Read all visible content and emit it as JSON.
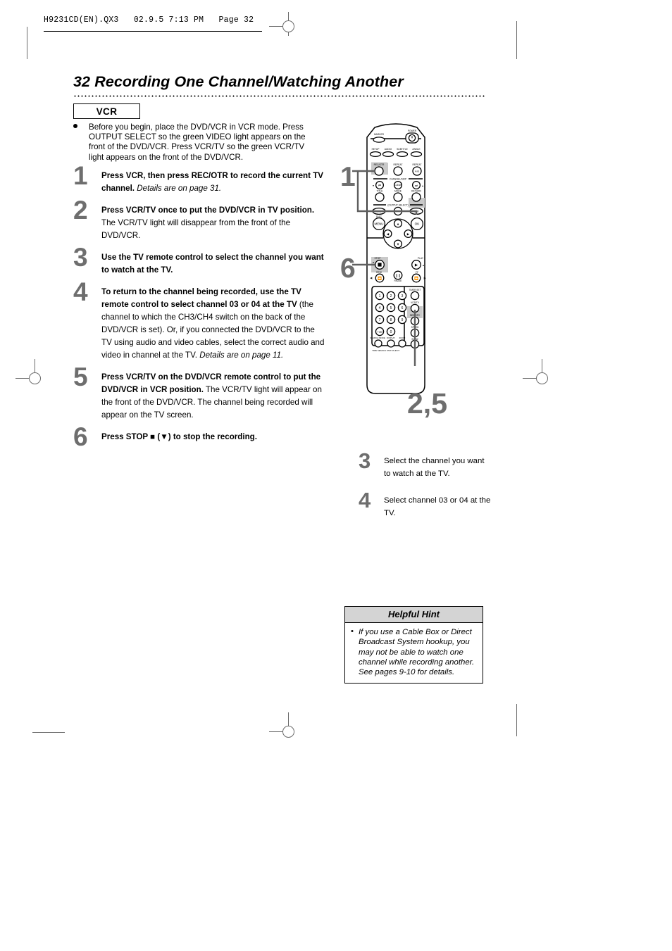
{
  "print_header": {
    "text": "H9231CD(EN).QX3   02.9.5 7:13 PM   Page 32"
  },
  "page": {
    "number": "32",
    "title": "32  Recording One Channel/Watching Another",
    "mode_badge": "VCR"
  },
  "intro": {
    "text": "Before you begin, place the DVD/VCR in VCR mode. Press OUTPUT SELECT so the green VIDEO light appears on the front of the DVD/VCR. Press VCR/TV so the green VCR/TV light appears on the front of the DVD/VCR."
  },
  "steps": [
    {
      "number": "1",
      "bold": "Press VCR, then press REC/OTR to record the current TV channel.",
      "italic": " Details are on page 31.",
      "plain": ""
    },
    {
      "number": "2",
      "bold": "Press VCR/TV once to put the DVD/VCR in TV position.",
      "italic": "",
      "plain": " The VCR/TV light will disappear from the front of the DVD/VCR."
    },
    {
      "number": "3",
      "bold": "Use the TV remote control to select the channel you want to watch at the TV.",
      "italic": "",
      "plain": ""
    },
    {
      "number": "4",
      "bold": "To return to the channel being recorded, use the TV remote control to select channel 03 or 04 at the TV",
      "italic": " Details are on page 11.",
      "plain": " (the channel to which the CH3/CH4 switch on the back of the DVD/VCR is set). Or, if you connected the DVD/VCR to the TV using audio and video cables, select the correct audio and video in channel at the TV."
    },
    {
      "number": "5",
      "bold": "Press VCR/TV on the DVD/VCR remote control to put the DVD/VCR in VCR position.",
      "italic": "",
      "plain": " The VCR/TV light will appear on the front of the DVD/VCR. The channel being recorded will appear on the TV screen."
    },
    {
      "number": "6",
      "bold": "Press STOP ■ (▼) to stop the recording.",
      "italic": "",
      "plain": ""
    }
  ],
  "remote": {
    "callout_top": "1",
    "callout_stop": "6",
    "callout_vcrtv": "2,5",
    "labels": {
      "marker": "MARKER",
      "power": "POWER",
      "setup": "SETUP",
      "audio": "AUDIO",
      "subtitle": "SUBTITLE",
      "angle": "ANGLE",
      "rec_otr": "REC/OTR",
      "repeat": "REPEAT",
      "repeat_ab_top": "REPEAT",
      "repeat_ab": "A-B",
      "channel_skip": "CHANNEL/SKIP",
      "title": "TITLE",
      "clear": "CLEAR",
      "mode": "MODE",
      "return": "RETURN",
      "output_select": "(OUTPUT SELECT)",
      "dvd": "DVD",
      "vcr": "VCR",
      "disc": "DISC",
      "menu": "MENU",
      "ok": "OK",
      "stop": "STOP",
      "play": "PLAY",
      "rew": "REW",
      "pause": "PAUSE",
      "ff": "FF",
      "timer_set": "TIMER SET",
      "vcr_tv": "VCR/TV",
      "memory": "MEMORY",
      "speed": "SPEED",
      "slow": "SLOW",
      "search_mode": "SEARCH MODE",
      "display": "DISPLAY",
      "zoom": "ZOOM",
      "time_search": "TIME SEARCH",
      "status_exit": "STATUS-EXIT",
      "plus10": "+10",
      "zero": "0"
    },
    "keypad": [
      "1",
      "2",
      "3",
      "4",
      "5",
      "6",
      "7",
      "8",
      "9"
    ]
  },
  "side_steps": [
    {
      "number": "3",
      "text": "Select the channel you want to watch at the TV."
    },
    {
      "number": "4",
      "text": "Select channel 03 or 04 at the TV."
    }
  ],
  "hint": {
    "heading": "Helpful Hint",
    "text": "If you use a Cable Box or Direct Broadcast System hookup, you may not be able to watch one channel while recording another. See pages 9-10 for details."
  },
  "colors": {
    "step_number": "#6e6e6e",
    "hint_header_bg": "#d4d4d4",
    "highlight": "#c9c9c9",
    "ink": "#000000"
  }
}
